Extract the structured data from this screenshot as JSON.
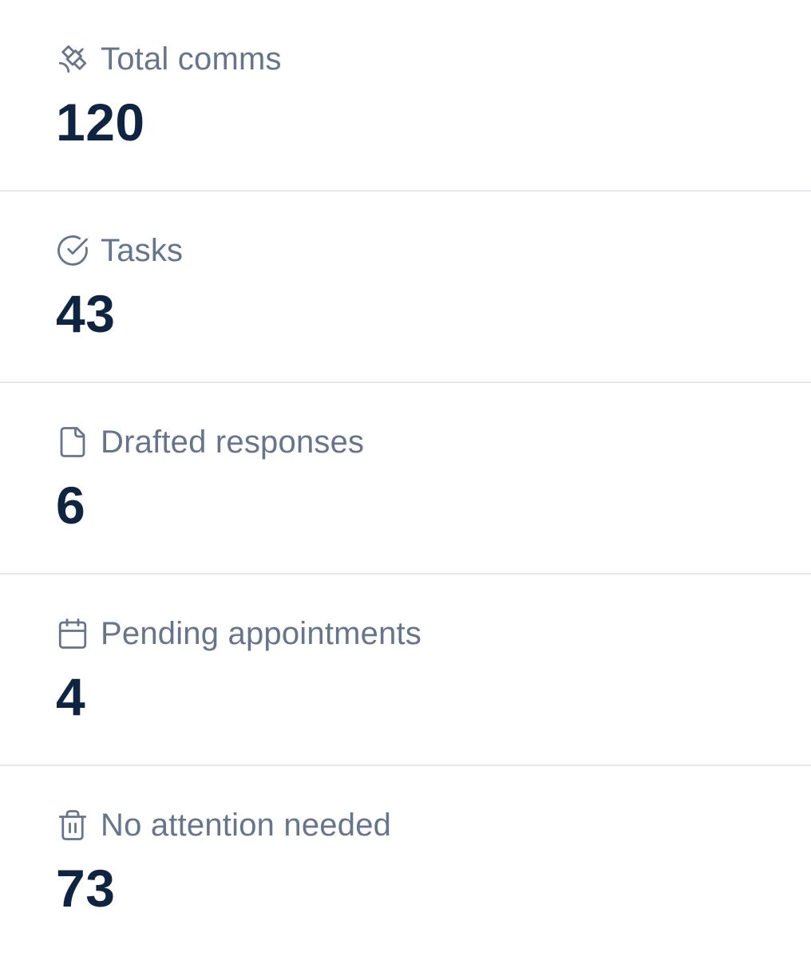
{
  "stats": [
    {
      "icon": "satellite-icon",
      "label": "Total comms",
      "value": "120"
    },
    {
      "icon": "check-circle-icon",
      "label": "Tasks",
      "value": "43"
    },
    {
      "icon": "document-icon",
      "label": "Drafted responses",
      "value": "6"
    },
    {
      "icon": "calendar-icon",
      "label": "Pending appointments",
      "value": "4"
    },
    {
      "icon": "trash-icon",
      "label": "No attention needed",
      "value": "73"
    }
  ],
  "colors": {
    "label": "#66758c",
    "value": "#0f2440",
    "divider": "#e3e7ee",
    "background": "#ffffff"
  }
}
